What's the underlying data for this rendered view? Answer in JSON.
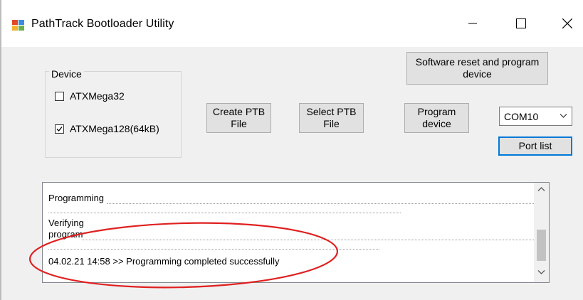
{
  "window": {
    "title": "PathTrack Bootloader Utility",
    "icon": "app-icon",
    "controls": [
      "minimize-icon",
      "maximize-icon",
      "close-icon"
    ]
  },
  "device_group": {
    "label": "Device",
    "options": [
      {
        "label": "ATXMega32",
        "checked": false
      },
      {
        "label": "ATXMega128(64kB)",
        "checked": true
      }
    ]
  },
  "buttons": {
    "create_ptb": "Create PTB\nFile",
    "select_ptb": "Select PTB\nFile",
    "program": "Program\ndevice",
    "software_reset": "Software reset and program\ndevice",
    "port_list": "Port list"
  },
  "port": {
    "selected": "COM10"
  },
  "log": {
    "lines": [
      "Programming",
      "Verifying",
      "program",
      "04.02.21 14:58 >> Programming completed successfully"
    ]
  },
  "colors": {
    "highlight_ellipse": "#e02020",
    "focus_border": "#0078d7"
  }
}
